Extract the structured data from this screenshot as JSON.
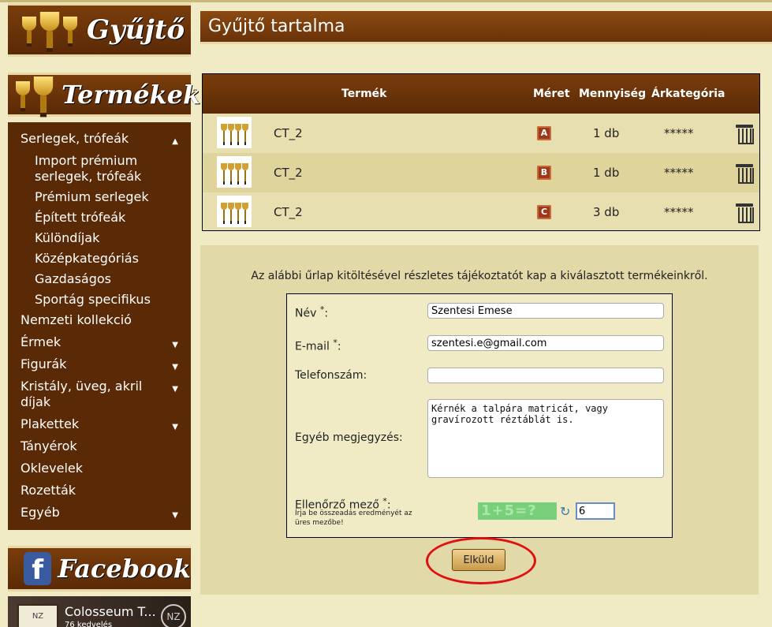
{
  "sidebar": {
    "logo_text": "Gyűjtő",
    "products_title": "Termékek",
    "menu": [
      {
        "label": "Serlegek, trófeák",
        "arrow": "▲"
      },
      {
        "label": "Import prémium serlegek, trófeák",
        "sub": true
      },
      {
        "label": "Prémium serlegek",
        "sub": true
      },
      {
        "label": "Épített trófeák",
        "sub": true
      },
      {
        "label": "Különdíjak",
        "sub": true
      },
      {
        "label": "Középkategóriás",
        "sub": true
      },
      {
        "label": "Gazdaságos",
        "sub": true
      },
      {
        "label": "Sportág specifikus",
        "sub": true
      },
      {
        "label": "Nemzeti kollekció"
      },
      {
        "label": "Érmek",
        "arrow": "▼"
      },
      {
        "label": "Figurák",
        "arrow": "▼"
      },
      {
        "label": "Kristály, üveg, akril díjak",
        "arrow": "▼"
      },
      {
        "label": "Plakettek",
        "arrow": "▼"
      },
      {
        "label": "Tányérok"
      },
      {
        "label": "Oklevelek"
      },
      {
        "label": "Rozetták"
      },
      {
        "label": "Egyéb",
        "arrow": "▼"
      }
    ],
    "facebook_title": "Facebook",
    "fb_page_name": "Colosseum T...",
    "fb_likes": "76 kedvelés"
  },
  "main": {
    "title": "Gyűjtő tartalma",
    "cart": {
      "headers": {
        "product": "Termék",
        "size": "Méret",
        "quantity": "Mennyiség",
        "price": "Árkategória"
      },
      "rows": [
        {
          "name": "CT_2",
          "size": "A",
          "quantity": "1 db",
          "price": "*****"
        },
        {
          "name": "CT_2",
          "size": "B",
          "quantity": "1 db",
          "price": "*****"
        },
        {
          "name": "CT_2",
          "size": "C",
          "quantity": "3 db",
          "price": "*****"
        }
      ]
    },
    "form": {
      "intro": "Az alábbi űrlap kitöltésével részletes tájékoztatót kap a kiválasztott termékeinkről.",
      "name_label": "Név",
      "name_value": "Szentesi Emese",
      "email_label": "E-mail",
      "email_value": "szentesi.e@gmail.com",
      "phone_label": "Telefonszám:",
      "phone_value": "",
      "notes_label": "Egyéb megjegyzés:",
      "notes_value": "Kérnék a talpára matricát, vagy\ngravírozott réztáblát is.",
      "captcha_label": "Ellenőrző mező",
      "captcha_hint": "Írja be összeadás eredményét az üres mezőbe!",
      "captcha_text": "1+5=?",
      "captcha_value": "6",
      "required_mark": "*",
      "colon": ":",
      "submit_label": "Elküld"
    }
  },
  "colors": {
    "brown": "#5a2a06",
    "beige": "#f0ebc4",
    "highlight": "#e01010"
  }
}
